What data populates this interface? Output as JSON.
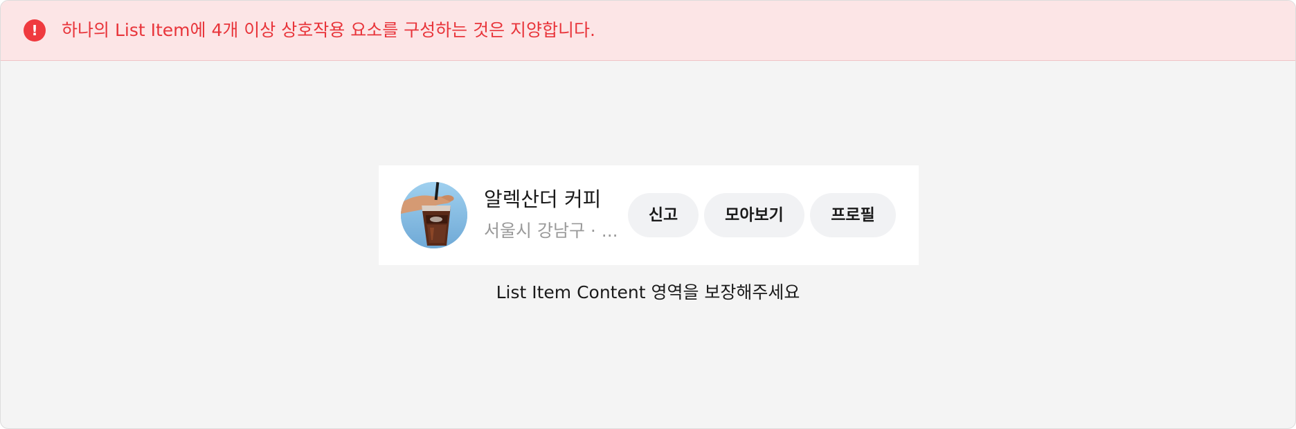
{
  "banner": {
    "icon": "exclamation-icon",
    "icon_glyph": "!",
    "message": "하나의 List Item에 4개 이상 상호작용 요소를 구성하는 것은 지양합니다.",
    "color": "#e8343a",
    "background": "#fce5e6"
  },
  "list_item": {
    "avatar": "iced-coffee-cup-photo",
    "title": "알렉산더 커피",
    "subtitle": "서울시 강남구 · ...",
    "buttons": [
      {
        "label": "신고"
      },
      {
        "label": "모아보기"
      },
      {
        "label": "프로필"
      }
    ]
  },
  "caption": "List Item Content 영역을 보장해주세요"
}
